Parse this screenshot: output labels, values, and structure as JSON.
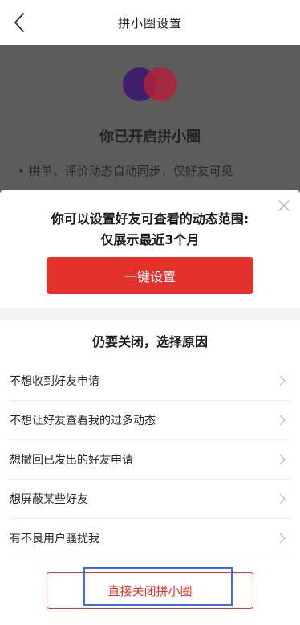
{
  "nav": {
    "title": "拼小圈设置",
    "back_icon": "chevron-left-icon"
  },
  "background": {
    "headline": "你已开启拼小圈",
    "bullet": "• 拼单、评价动态自动同步，仅好友可见"
  },
  "sheet": {
    "prompt_line1": "你可以设置好友可查看的动态范围:",
    "prompt_line2": "仅展示最近3个月",
    "primary_button": "一键设置",
    "section_title": "仍要关闭，选择原因",
    "reasons": [
      {
        "label": "不想收到好友申请"
      },
      {
        "label": "不想让好友查看我的过多动态"
      },
      {
        "label": "想撤回已发出的好友申请"
      },
      {
        "label": "想屏蔽某些好友"
      },
      {
        "label": "有不良用户骚扰我"
      }
    ],
    "close_button": "直接关闭拼小圈"
  },
  "colors": {
    "accent_red": "#e3322b",
    "highlight_blue": "#3a6fe0",
    "overlay": "#5c5c5c"
  }
}
